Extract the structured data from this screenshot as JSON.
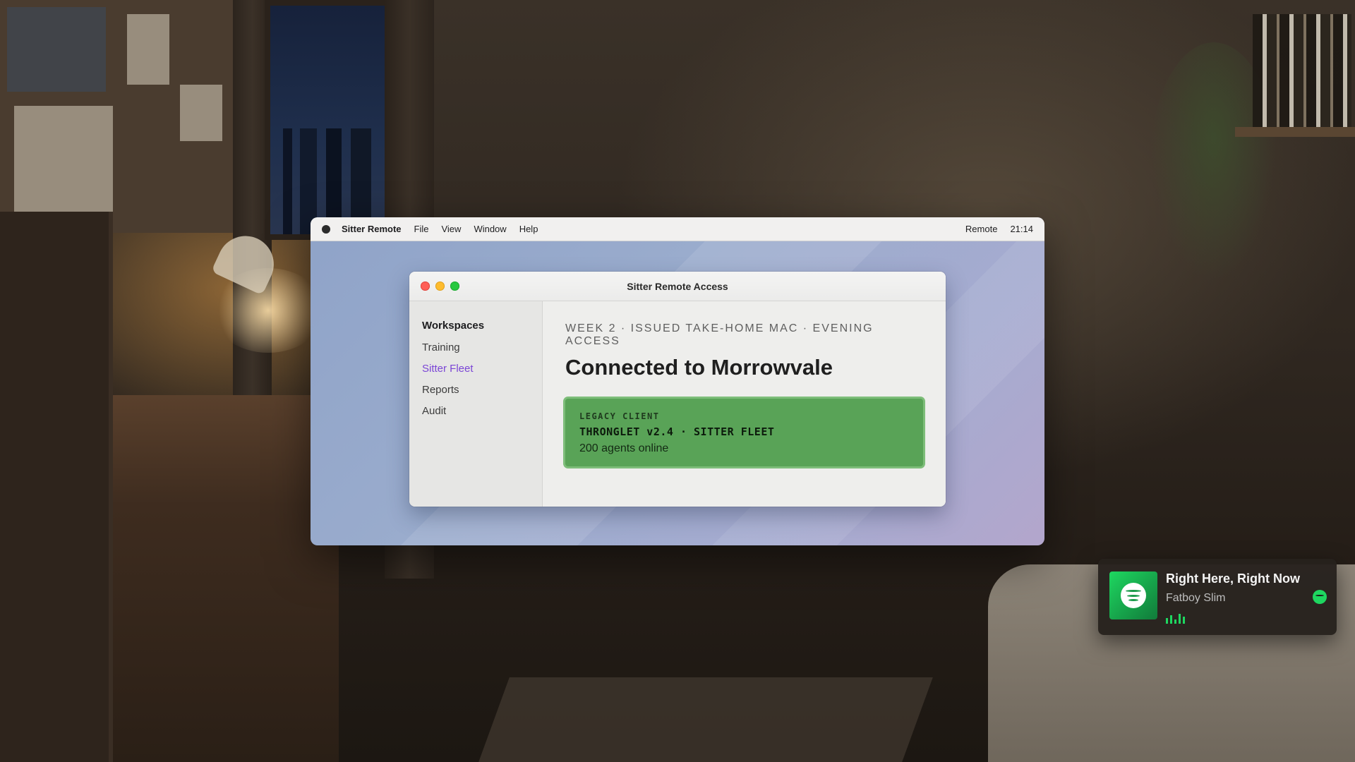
{
  "menubar": {
    "app_name": "Sitter Remote",
    "items": [
      "File",
      "View",
      "Window",
      "Help"
    ],
    "status_label": "Remote",
    "clock": "21:14"
  },
  "window": {
    "title": "Sitter Remote Access"
  },
  "sidebar": {
    "heading": "Workspaces",
    "items": [
      {
        "label": "Training",
        "active": false
      },
      {
        "label": "Sitter Fleet",
        "active": true
      },
      {
        "label": "Reports",
        "active": false
      },
      {
        "label": "Audit",
        "active": false
      }
    ]
  },
  "main": {
    "eyebrow": "WEEK 2 · ISSUED TAKE-HOME MAC · EVENING ACCESS",
    "heading": "Connected to Morrowvale",
    "card": {
      "label": "LEGACY CLIENT",
      "client": "THRONGLET v2.4 · SITTER FLEET",
      "status": "200 agents online"
    }
  },
  "now_playing": {
    "track": "Right Here, Right Now",
    "artist": "Fatboy Slim",
    "service_icon": "spotify-icon"
  },
  "colors": {
    "accent": "#7b45d6",
    "card_green": "#59a357",
    "spotify_green": "#1ed760"
  }
}
